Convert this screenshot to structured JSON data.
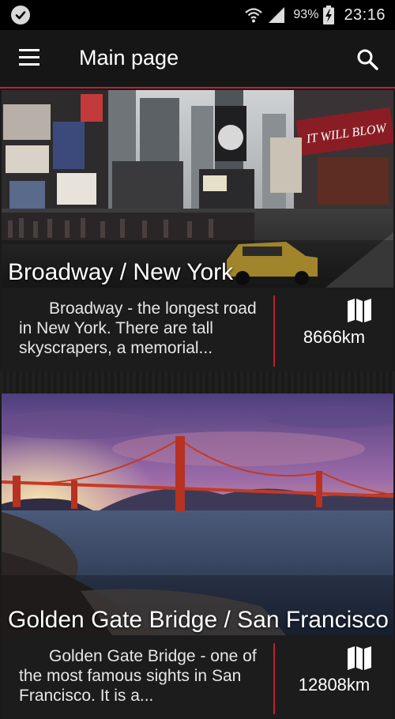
{
  "status_bar": {
    "battery": "93%",
    "time": "23:16"
  },
  "app_bar": {
    "title": "Main page"
  },
  "cards": [
    {
      "title": "Broadway / New York",
      "description": "Broadway - the longest road in New York.  There are tall skyscrapers, a memorial...",
      "distance": "8666km",
      "sign_text": "IT WILL BLOW"
    },
    {
      "title": "Golden Gate Bridge / San Francisco",
      "description": "Golden Gate Bridge - one of the most famous sights in San Francisco. It is a...",
      "distance": "12808km"
    }
  ],
  "colors": {
    "accent": "#c21f2e",
    "background": "#1a1a1a",
    "app_bar": "#161616"
  },
  "icons": {
    "status_app": "check-badge-icon",
    "wifi": "wifi-icon",
    "signal": "signal-icon",
    "battery": "battery-charging-icon",
    "menu": "menu-icon",
    "search": "search-icon",
    "map": "map-icon"
  }
}
